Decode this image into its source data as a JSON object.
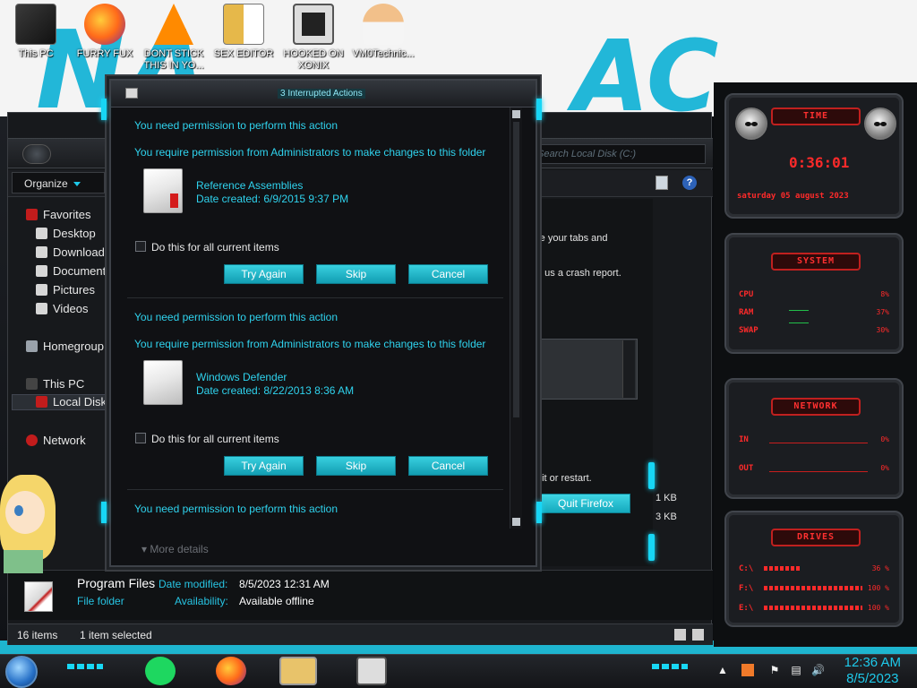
{
  "desktop": {
    "icons": [
      {
        "label": "This PC",
        "icon": "this-pc-icon"
      },
      {
        "label": "FURRY FUX",
        "icon": "firefox-icon"
      },
      {
        "label": "DONT STICK THIS IN YO...",
        "icon": "vlc-icon"
      },
      {
        "label": "SEX EDITOR",
        "icon": "hex-editor-icon"
      },
      {
        "label": "HOOKED ON XONIX",
        "icon": "game-icon"
      },
      {
        "label": "VM0Technic...",
        "icon": "doctor-icon"
      }
    ]
  },
  "explorer": {
    "search_placeholder": "Search Local Disk (C:)",
    "organize_label": "Organize",
    "nav": {
      "favorites": "Favorites",
      "desktop": "Desktop",
      "downloads": "Downloads",
      "documents": "Document",
      "pictures": "Pictures",
      "videos": "Videos",
      "homegroup": "Homegroup",
      "this_pc": "This PC",
      "local_disk": "Local Disk",
      "network": "Network"
    },
    "background_text": {
      "line1": "re your tabs and",
      "line2": "d us a crash report.",
      "line3": "uit or restart.",
      "quit_button": "Quit Firefox",
      "size1": "1 KB",
      "size2": "3 KB"
    },
    "details": {
      "name": "Program Files",
      "type": "File folder",
      "date_label": "Date modified:",
      "date_value": "8/5/2023 12:31 AM",
      "avail_label": "Availability:",
      "avail_value": "Available offline"
    },
    "status": {
      "count": "16 items",
      "selected": "1 item selected"
    }
  },
  "dialog": {
    "title": "3 Interrupted Actions",
    "items": [
      {
        "heading": "You need permission to perform this action",
        "subheading": "You require permission from Administrators to make changes to this folder",
        "file_name": "Reference Assemblies",
        "file_date": "Date created: 6/9/2015 9:37 PM",
        "checkbox_label": "Do this for all current items",
        "try_again": "Try Again",
        "skip": "Skip",
        "cancel": "Cancel"
      },
      {
        "heading": "You need permission to perform this action",
        "subheading": "You require permission from Administrators to make changes to this folder",
        "file_name": "Windows Defender",
        "file_date": "Date created: 8/22/2013 8:36 AM",
        "checkbox_label": "Do this for all current items",
        "try_again": "Try Again",
        "skip": "Skip",
        "cancel": "Cancel"
      },
      {
        "heading": "You need permission to perform this action"
      }
    ],
    "more_details": "More details"
  },
  "gadgets": {
    "time": {
      "title": "TIME",
      "clock": "0:36:01",
      "date": "saturday 05 august 2023"
    },
    "system": {
      "title": "SYSTEM",
      "rows": [
        {
          "label": "CPU",
          "value": "8%"
        },
        {
          "label": "RAM",
          "value": "37%"
        },
        {
          "label": "SWAP",
          "value": "30%"
        }
      ]
    },
    "network": {
      "title": "NETWORK",
      "rows": [
        {
          "label": "IN",
          "value": "0%"
        },
        {
          "label": "OUT",
          "value": "0%"
        }
      ]
    },
    "drives": {
      "title": "DRIVES",
      "rows": [
        {
          "label": "C:\\",
          "value": "36 %"
        },
        {
          "label": "F:\\",
          "value": "100 %"
        },
        {
          "label": "E:\\",
          "value": "100 %"
        }
      ]
    }
  },
  "taskbar": {
    "time": "12:36 AM",
    "date": "8/5/2023"
  },
  "colors": {
    "accent_cyan": "#1ec9ea",
    "gadget_red": "#ff2a2a",
    "button_teal": "#22b9cc"
  }
}
